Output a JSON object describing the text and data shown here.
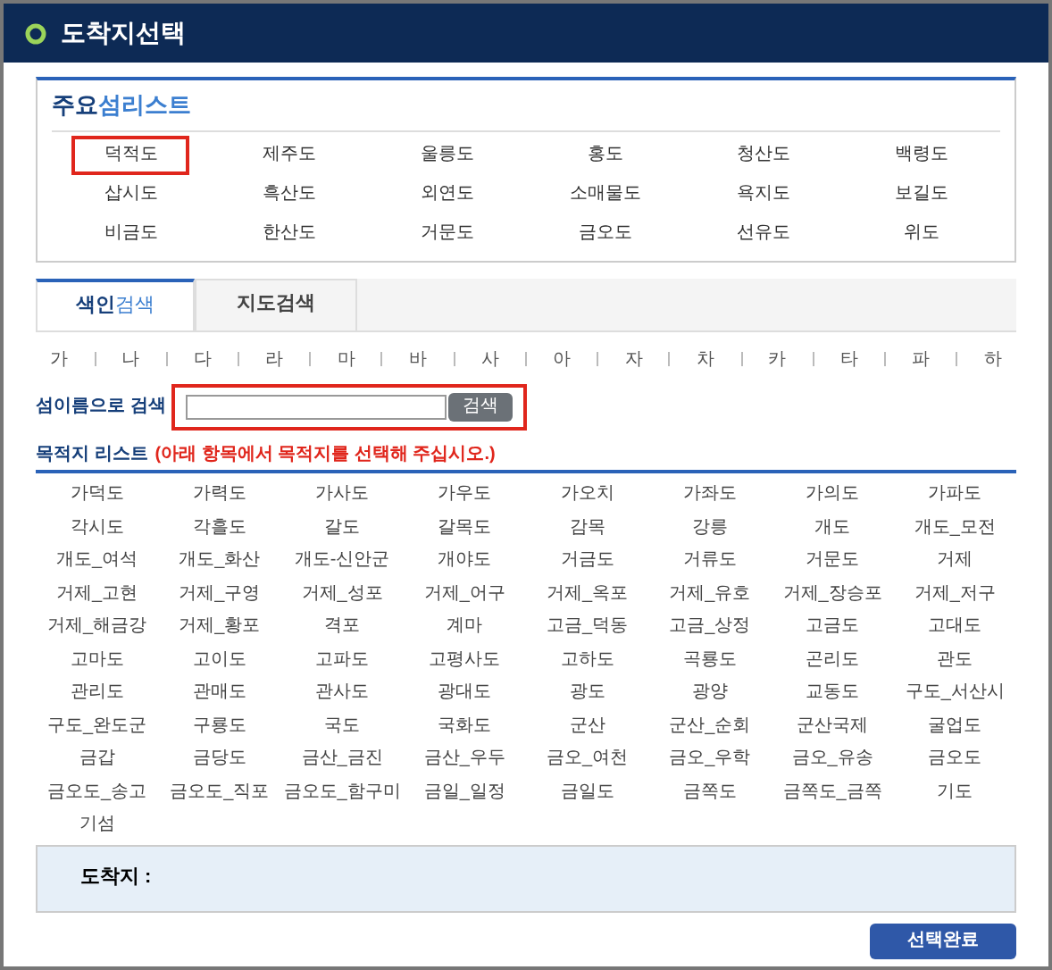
{
  "window": {
    "title": "도착지선택"
  },
  "main_islands": {
    "title_bold": "주요",
    "title_rest": "섬리스트",
    "items": [
      {
        "label": "덕적도",
        "selected": true
      },
      {
        "label": "제주도",
        "selected": false
      },
      {
        "label": "울릉도",
        "selected": false
      },
      {
        "label": "홍도",
        "selected": false
      },
      {
        "label": "청산도",
        "selected": false
      },
      {
        "label": "백령도",
        "selected": false
      },
      {
        "label": "삽시도",
        "selected": false
      },
      {
        "label": "흑산도",
        "selected": false
      },
      {
        "label": "외연도",
        "selected": false
      },
      {
        "label": "소매물도",
        "selected": false
      },
      {
        "label": "욕지도",
        "selected": false
      },
      {
        "label": "보길도",
        "selected": false
      },
      {
        "label": "비금도",
        "selected": false
      },
      {
        "label": "한산도",
        "selected": false
      },
      {
        "label": "거문도",
        "selected": false
      },
      {
        "label": "금오도",
        "selected": false
      },
      {
        "label": "선유도",
        "selected": false
      },
      {
        "label": "위도",
        "selected": false
      }
    ]
  },
  "tabs": [
    {
      "label_bold": "색인",
      "label_rest": "검색",
      "selected": true
    },
    {
      "label_rest": "지도검색",
      "selected": false
    }
  ],
  "index_letters": [
    "가",
    "나",
    "다",
    "라",
    "마",
    "바",
    "사",
    "아",
    "자",
    "차",
    "카",
    "타",
    "파",
    "하"
  ],
  "search": {
    "label": "섬이름으로 검색",
    "button": "검색",
    "highlighted": true
  },
  "destination_list": {
    "title": "목적지 리스트",
    "note": "(아래 항목에서 목적지를 선택해 주십시오.)",
    "items": [
      "가덕도",
      "가력도",
      "가사도",
      "가우도",
      "가오치",
      "가좌도",
      "가의도",
      "가파도",
      "각시도",
      "각흘도",
      "갈도",
      "갈목도",
      "감목",
      "강릉",
      "개도",
      "개도_모전",
      "개도_여석",
      "개도_화산",
      "개도-신안군",
      "개야도",
      "거금도",
      "거류도",
      "거문도",
      "거제",
      "거제_고현",
      "거제_구영",
      "거제_성포",
      "거제_어구",
      "거제_옥포",
      "거제_유호",
      "거제_장승포",
      "거제_저구",
      "거제_해금강",
      "거제_황포",
      "격포",
      "계마",
      "고금_덕동",
      "고금_상정",
      "고금도",
      "고대도",
      "고마도",
      "고이도",
      "고파도",
      "고평사도",
      "고하도",
      "곡룡도",
      "곤리도",
      "관도",
      "관리도",
      "관매도",
      "관사도",
      "광대도",
      "광도",
      "광양",
      "교동도",
      "구도_서산시",
      "구도_완도군",
      "구룡도",
      "국도",
      "국화도",
      "군산",
      "군산_순회",
      "군산국제",
      "굴업도",
      "금갑",
      "금당도",
      "금산_금진",
      "금산_우두",
      "금오_여천",
      "금오_우학",
      "금오_유송",
      "금오도",
      "금오도_송고",
      "금오도_직포",
      "금오도_함구미",
      "금일_일정",
      "금일도",
      "금쪽도",
      "금쪽도_금쪽",
      "기도",
      "기섬"
    ]
  },
  "destination": {
    "label": "도착지 :"
  },
  "confirm_button": "선택완료"
}
